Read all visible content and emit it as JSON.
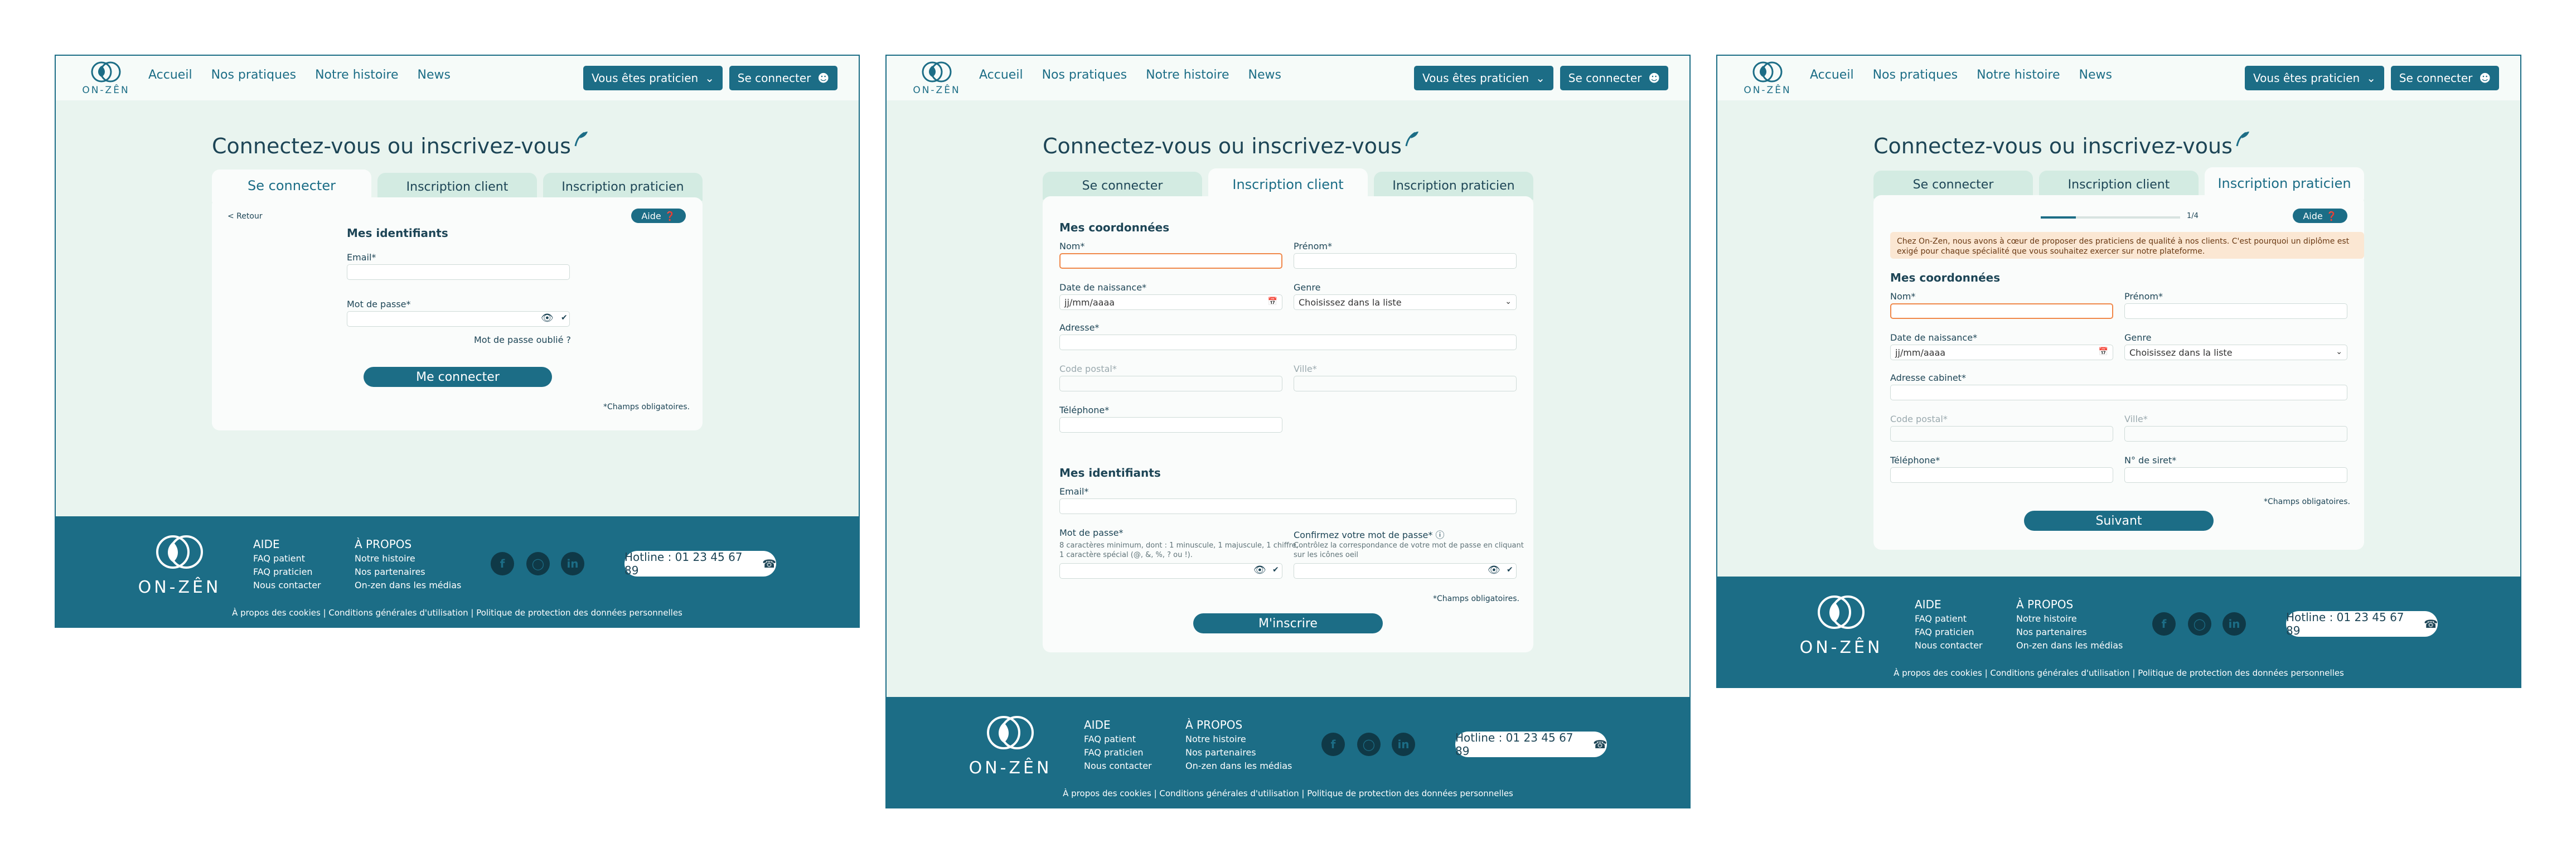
{
  "colors": {
    "primary": "#1c6d86",
    "background": "#e9f4ef",
    "card": "#fafcfb",
    "tab_inactive": "#d3ebe2",
    "error_border": "#f0884a",
    "notice_bg": "#fbe7d3"
  },
  "header": {
    "logo_text": "ON-ZÊN",
    "nav": [
      "Accueil",
      "Nos pratiques",
      "Notre histoire",
      "News"
    ],
    "practitioner_button": "Vous êtes praticien",
    "login_button": "Se connecter"
  },
  "title": "Connectez-vous ou inscrivez-vous",
  "tabs": [
    "Se connecter",
    "Inscription client",
    "Inscription praticien"
  ],
  "login": {
    "back": "< Retour",
    "help": "Aide",
    "section": "Mes identifiants",
    "email_label": "Email*",
    "password_label": "Mot de passe*",
    "forgot": "Mot de passe oublié ?",
    "submit": "Me connecter",
    "required_note": "*Champs obligatoires."
  },
  "client": {
    "section_contact": "Mes coordonnées",
    "nom": "Nom*",
    "prenom": "Prénom*",
    "dob_label": "Date de naissance*",
    "dob_placeholder": "jj/mm/aaaa",
    "genre_label": "Genre",
    "genre_value": "Choisissez dans la liste",
    "adresse": "Adresse*",
    "code_postal": "Code postal*",
    "ville": "Ville*",
    "telephone": "Téléphone*",
    "section_ids": "Mes identifiants",
    "email": "Email*",
    "password": "Mot de passe*",
    "password_hint_1": "8 caractères minimum, dont : 1 minuscule, 1 majuscule, 1 chiffre,",
    "password_hint_2": "1 caractère spécial (@, &, %, ? ou !).",
    "confirm": "Confirmez votre mot de passe*",
    "confirm_hint_1": "Contrôlez la correspondance de votre mot de passe en cliquant",
    "confirm_hint_2": "sur les icônes oeil",
    "required_note": "*Champs obligatoires.",
    "submit": "M'inscrire"
  },
  "practitioner": {
    "step": "1/4",
    "help": "Aide",
    "progress": 0.25,
    "notice_1": "Chez On-Zen, nous avons à cœur de proposer des praticiens de qualité à nos clients. C'est pourquoi un diplôme est",
    "notice_2": "exigé pour chaque spécialité que vous souhaitez exercer sur notre plateforme.",
    "section": "Mes coordonnées",
    "nom": "Nom*",
    "prenom": "Prénom*",
    "dob_label": "Date de naissance*",
    "dob_placeholder": "jj/mm/aaaa",
    "genre_label": "Genre",
    "genre_value": "Choisissez dans la liste",
    "adresse": "Adresse cabinet*",
    "code_postal": "Code postal*",
    "ville": "Ville*",
    "telephone": "Téléphone*",
    "siret": "N° de siret*",
    "required_note": "*Champs obligatoires.",
    "submit": "Suivant"
  },
  "footer": {
    "logo_text": "ON-ZÊN",
    "aide_head": "AIDE",
    "aide_links": [
      "FAQ patient",
      "FAQ praticien",
      "Nous contacter"
    ],
    "apropos_head": "À PROPOS",
    "apropos_links": [
      "Notre histoire",
      "Nos partenaires",
      "On-zen dans les médias"
    ],
    "social_icons": [
      "facebook-icon",
      "instagram-icon",
      "linkedin-icon"
    ],
    "hotline": "Hotline : 01 23 45 67 89",
    "legal": "À propos des cookies | Conditions générales d'utilisation | Politique de protection des données personnelles"
  }
}
